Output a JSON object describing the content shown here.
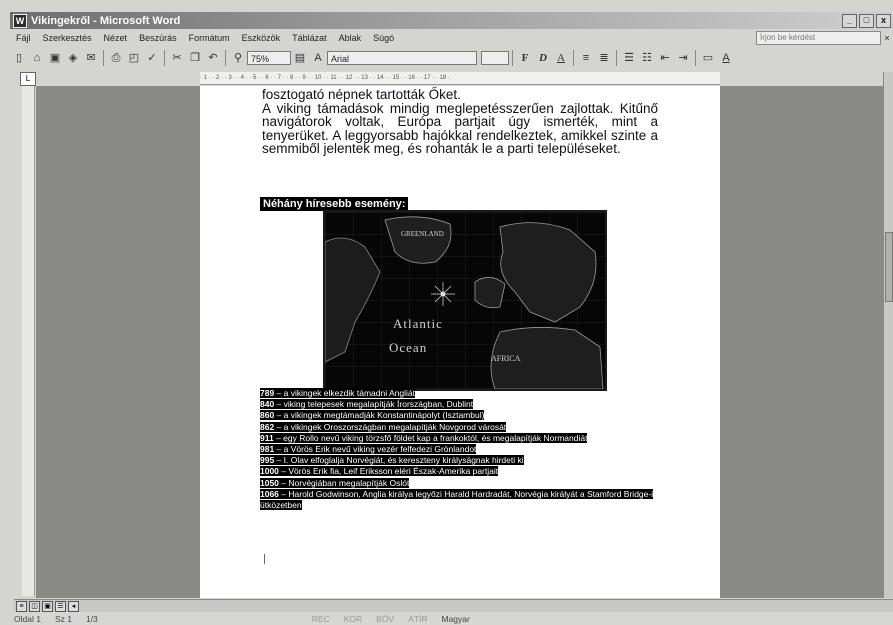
{
  "window": {
    "title": "Vikingekről - Microsoft Word",
    "min": "_",
    "restore": "□",
    "close": "x"
  },
  "menu": [
    "Fájl",
    "Szerkesztés",
    "Nézet",
    "Beszúrás",
    "Formátum",
    "Eszközök",
    "Táblázat",
    "Ablak",
    "Súgó"
  ],
  "help_box": "Írjon be kérdést",
  "toolbar": {
    "zoom": "75%",
    "font": "Arial",
    "bold": "F",
    "italic": "D",
    "underline": "A"
  },
  "document": {
    "line1": "fosztogató népnek tartották Őket.",
    "paragraph": "A viking támadások mindig meglepetésszerűen zajlottak. Kitűnő navigátorok voltak, Európa partjait úgy ismerték, mint a tenyerüket. A leggyorsabb hajókkal rendelkeztek, amikkel szinte a semmiből jelentek meg, és rohanták le a parti településeket.",
    "heading": "Néhány híresebb esemény:",
    "map_labels": {
      "greenland": "GREENLAND",
      "atlantic": "Atlantic",
      "ocean": "Ocean",
      "africa": "AFRICA"
    },
    "events": [
      {
        "year": "789",
        "text": " – a vikingek elkezdik támadni Angliát"
      },
      {
        "year": "840",
        "text": " – viking telepesek megalapítják Írországban, Dublint"
      },
      {
        "year": "860",
        "text": " – a vikingek megtámadják Konstantinápolyt (Isztambul)"
      },
      {
        "year": "862",
        "text": " – a vikingek Oroszországban megalapítják Novgorod városát"
      },
      {
        "year": "911",
        "text": " – egy Rollo nevű viking törzsfő földet kap a frankoktól, és megalapítják Normandiát"
      },
      {
        "year": "981",
        "text": " – a Vörös Erik nevű viking vezér felfedezi Grönlandot"
      },
      {
        "year": "995",
        "text": " – I. Olav elfoglalja Norvégiát, és kereszteny királyságnak hirdeti ki"
      },
      {
        "year": "1000",
        "text": " – Vörös Erik fia, Leif Eriksson eléri Észak-Amerika partjait"
      },
      {
        "year": "1050",
        "text": " – Norvégiában megalapítják Oslót"
      },
      {
        "year": "1066",
        "text": " – Harold Godwinson, Anglia királya legyőzi Harald Hardradát, Norvégia királyát a Stamford Bridge-i ütközetben"
      }
    ]
  },
  "status": {
    "page": "Oldal 1",
    "section": "Sz 1",
    "pages": "1/3",
    "lang": "Magyar",
    "modes": [
      "REC",
      "KOR",
      "BŐV",
      "ÁTÍR"
    ]
  }
}
